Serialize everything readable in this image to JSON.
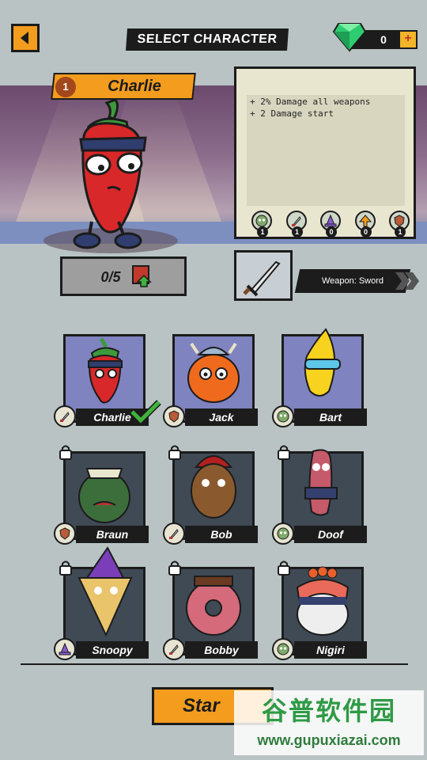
{
  "header": {
    "title": "SELECT CHARACTER",
    "gems": "0",
    "add_label": "+"
  },
  "selected": {
    "rank": "1",
    "name": "Charlie",
    "perks": [
      "+ 2% Damage all weapons",
      "+ 2 Damage start"
    ],
    "bonus_values": [
      "1",
      "1",
      "0",
      "0",
      "1"
    ],
    "bonus_icons": [
      "zombie-head-icon",
      "knife-icon",
      "wizard-hat-icon",
      "arrow-up-icon",
      "shield-icon"
    ],
    "progress": "0/5",
    "weapon_label": "Weapon: Sword"
  },
  "characters": [
    {
      "name": "Charlie",
      "locked": false,
      "badge": "knife-icon",
      "selected": true
    },
    {
      "name": "Jack",
      "locked": false,
      "badge": "shield-icon",
      "selected": false
    },
    {
      "name": "Bart",
      "locked": false,
      "badge": "zombie-head-icon",
      "selected": false
    },
    {
      "name": "Braun",
      "locked": true,
      "badge": "shield-icon",
      "selected": false
    },
    {
      "name": "Bob",
      "locked": true,
      "badge": "knife-icon",
      "selected": false
    },
    {
      "name": "Doof",
      "locked": true,
      "badge": "zombie-head-icon",
      "selected": false
    },
    {
      "name": "Snoopy",
      "locked": true,
      "badge": "wizard-hat-icon",
      "selected": false
    },
    {
      "name": "Bobby",
      "locked": true,
      "badge": "knife-icon",
      "selected": false
    },
    {
      "name": "Nigiri",
      "locked": true,
      "badge": "zombie-head-icon",
      "selected": false
    }
  ],
  "start_label": "Star",
  "watermark": {
    "cn": "谷普软件园",
    "url": "www.gupuxiazai.com"
  },
  "colors": {
    "accent": "#f39c1e",
    "background": "#b9c3c4",
    "card_unlocked": "#7f83bf",
    "card_locked": "#3f4a55",
    "check": "#3fb33b"
  }
}
